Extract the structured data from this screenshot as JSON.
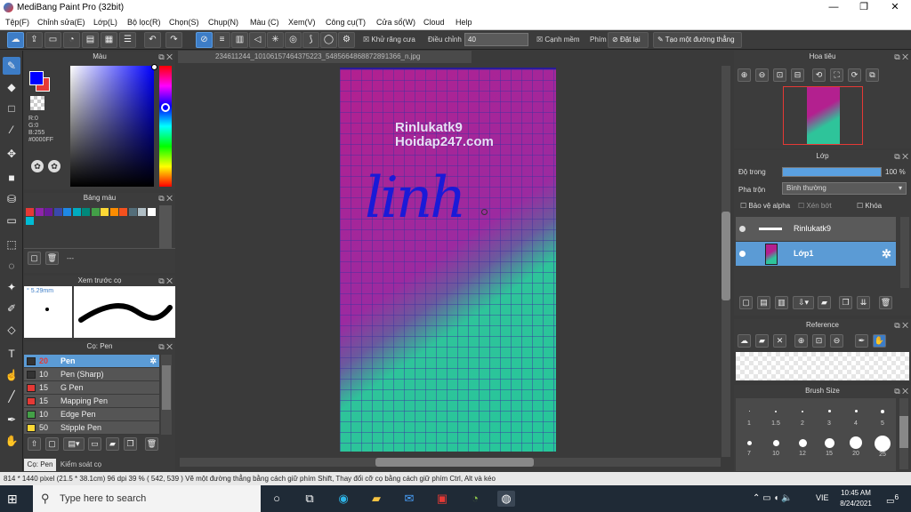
{
  "window": {
    "title": "MediBang Paint Pro (32bit)",
    "minimize": "—",
    "restore": "❐",
    "close": "✕"
  },
  "menu": [
    "Tệp(F)",
    "Chỉnh sửa(E)",
    "Lớp(L)",
    "Bộ lọc(R)",
    "Chọn(S)",
    "Chụp(N)",
    "Màu (C)",
    "Xem(V)",
    "Công cụ(T)",
    "Cửa sổ(W)",
    "Cloud",
    "Help"
  ],
  "toolbar": {
    "antialias_label": "Khử răng cưa",
    "adjust_label": "Điều chỉnh",
    "adjust_value": "40",
    "edge_label": "Cạnh mềm",
    "key_label": "Phím",
    "reset_label": "Đặt lại",
    "straight_line_label": "Tạo một đường thẳng"
  },
  "color_panel": {
    "title": "Màu",
    "r": "R:0",
    "g": "G:0",
    "b": "B:255",
    "hex": "#0000FF",
    "primary": "#0000ff",
    "secondary": "#e53935"
  },
  "palette_panel": {
    "title": "Bảng màu",
    "swatches": [
      "#e53935",
      "#8e24aa",
      "#6a1b9a",
      "#3949ab",
      "#1e88e5",
      "#00acc1",
      "#00897b",
      "#43a047",
      "#fdd835",
      "#fb8c00",
      "#f4511e",
      "#546e7a",
      "#b0bec5",
      "#ffffff",
      "#00bcd4"
    ],
    "footer": "---"
  },
  "preview_panel": {
    "title": "Xem trước cọ",
    "size": "5.29mm"
  },
  "brush_panel": {
    "title": "Cọ: Pen",
    "items": [
      {
        "size": "20",
        "name": "Pen",
        "color": "#333333"
      },
      {
        "size": "10",
        "name": "Pen (Sharp)",
        "color": "#333333"
      },
      {
        "size": "15",
        "name": "G Pen",
        "color": "#e53935"
      },
      {
        "size": "15",
        "name": "Mapping Pen",
        "color": "#e53935"
      },
      {
        "size": "10",
        "name": "Edge Pen",
        "color": "#43a047"
      },
      {
        "size": "50",
        "name": "Stipple Pen",
        "color": "#fdd835"
      }
    ],
    "tab1": "Cọ: Pen",
    "tab2": "Kiểm soát cọ"
  },
  "document": {
    "tab": "234611244_10106157464375223_5485664868872891366_n.jpg",
    "watermark1": "Rinlukatk9",
    "watermark2": "Hoidap247.com",
    "handwriting": "linh"
  },
  "navigator": {
    "title": "Hoa tiêu"
  },
  "layers": {
    "title": "Lớp",
    "opacity_label": "Độ trong",
    "opacity_value": "100 %",
    "blend_label": "Pha trộn",
    "blend_value": "Bình thường",
    "protect_alpha": "Bảo vệ alpha",
    "clip": "Xén bớt",
    "lock": "Khóa",
    "items": [
      {
        "name": "Rinlukatk9"
      },
      {
        "name": "Lớp1"
      }
    ]
  },
  "reference": {
    "title": "Reference"
  },
  "brush_size": {
    "title": "Brush Size",
    "row1": [
      "1",
      "1.5",
      "2",
      "3",
      "4",
      "5"
    ],
    "row2": [
      "7",
      "10",
      "12",
      "15",
      "20",
      "25"
    ]
  },
  "status": "814 * 1440 pixel   (21.5 * 38.1cm)   96 dpi   39 %   ( 542, 539 )   Vẽ một đường thẳng bằng cách giữ phím Shift, Thay đổi cỡ cọ bằng cách giữ phím Ctrl, Alt và kéo",
  "taskbar": {
    "search_placeholder": "Type here to search",
    "lang": "VIE",
    "time": "10:45 AM",
    "date": "8/24/2021",
    "notifications": "6"
  }
}
